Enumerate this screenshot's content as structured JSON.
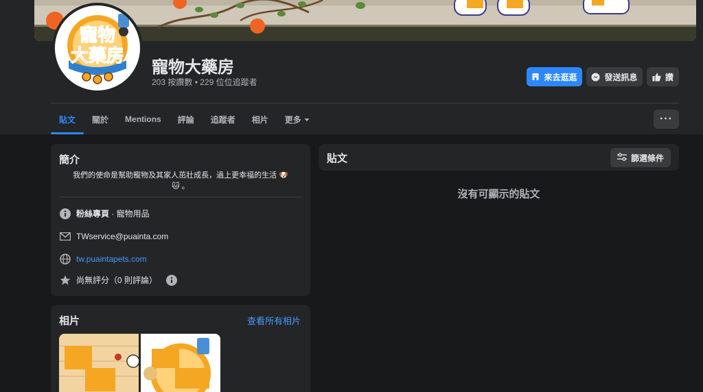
{
  "page": {
    "name": "寵物大藥房",
    "stats": "203 按讚數 • 229 位位追蹤者",
    "logo_text_top": "寵物",
    "logo_text_bottom": "大藥房"
  },
  "actions": {
    "shop_label": "來去逛逛",
    "message_label": "發送訊息",
    "like_label": "讚"
  },
  "tabs": [
    {
      "label": "貼文",
      "active": true
    },
    {
      "label": "關於"
    },
    {
      "label": "Mentions"
    },
    {
      "label": "評論"
    },
    {
      "label": "追蹤者"
    },
    {
      "label": "相片"
    },
    {
      "label": "更多"
    }
  ],
  "more_menu_label": "···",
  "intro": {
    "title": "簡介",
    "description_line1": "我們的使命是幫助寵物及其家人茁壯成長，過上更幸福的生活 🐶",
    "description_line2": "🐱 。",
    "category_bold": "粉絲專頁",
    "category_rest": " · 寵物用品",
    "email": "TWservice@puainta.com",
    "website": "tw.puaintapets.com",
    "rating": "尚無評分（0 則評論）"
  },
  "photos": {
    "title": "相片",
    "see_all": "查看所有相片"
  },
  "posts": {
    "title": "貼文",
    "filter_label": "篩選條件",
    "empty_message": "沒有可顯示的貼文"
  },
  "colors": {
    "accent": "#2d88ff",
    "background": "#18191a",
    "card": "#242526",
    "link": "#4599ff"
  },
  "icons": [
    "store-icon",
    "messenger-icon",
    "thumbs-up-icon",
    "caret-down-icon",
    "info-icon",
    "mail-icon",
    "globe-icon",
    "star-icon",
    "info-circle-icon",
    "sliders-icon"
  ]
}
